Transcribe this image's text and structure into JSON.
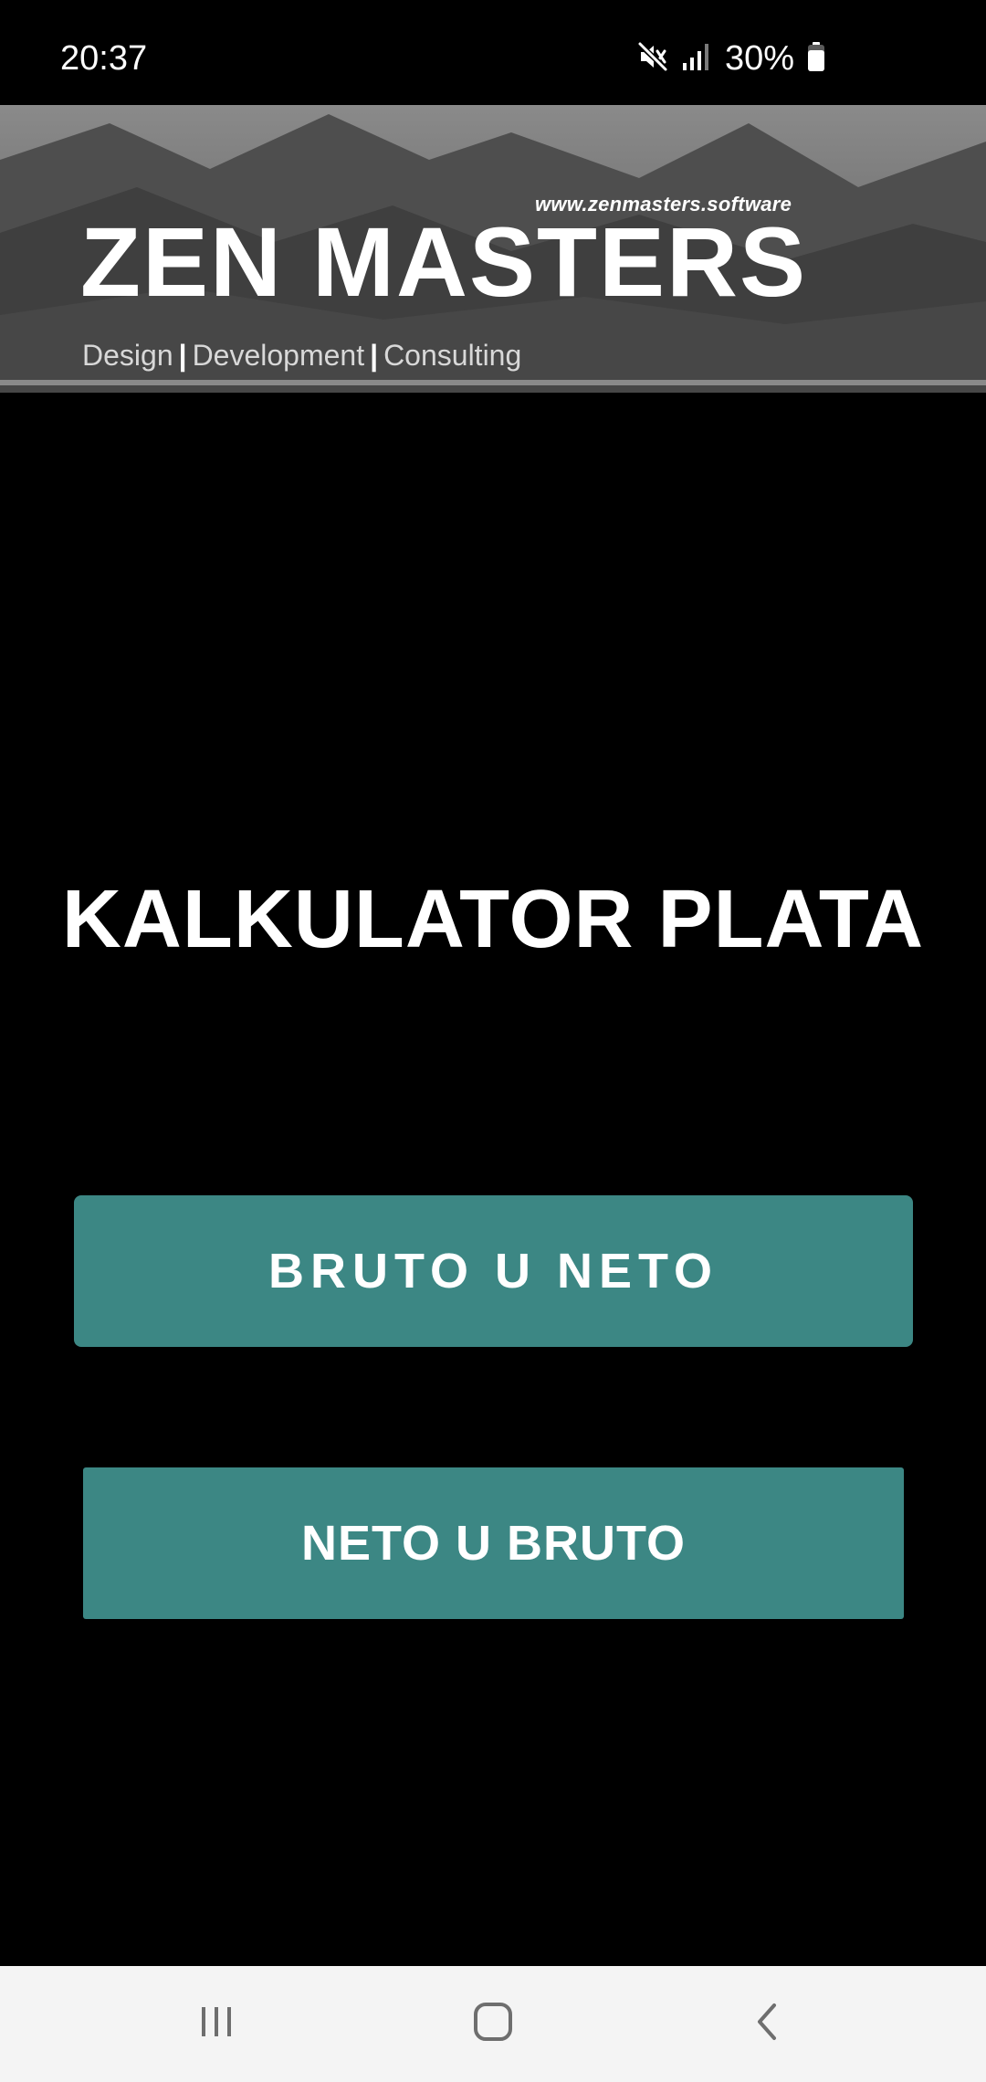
{
  "status_bar": {
    "time": "20:37",
    "battery_percent": "30%",
    "battery_level": 0.3,
    "icons": [
      "mute-icon",
      "signal-icon",
      "battery-icon"
    ]
  },
  "banner": {
    "url": "www.zenmasters.software",
    "title": "ZEN MASTERS",
    "tagline": {
      "part1": "Design",
      "part2": "Development",
      "part3": "Consulting",
      "separator": "|"
    }
  },
  "main": {
    "title": "KALKULATOR PLATA",
    "buttons": {
      "bruto_u_neto": "BRUTO U NETO",
      "neto_u_bruto": "NETO U BRUTO"
    }
  },
  "nav_bar": {
    "icons": [
      "recents-icon",
      "home-icon",
      "back-icon"
    ]
  },
  "colors": {
    "background": "#000000",
    "button": "#3c8784",
    "text": "#ffffff",
    "nav_bar": "#f4f4f4",
    "nav_icon": "#6e6e6e"
  }
}
